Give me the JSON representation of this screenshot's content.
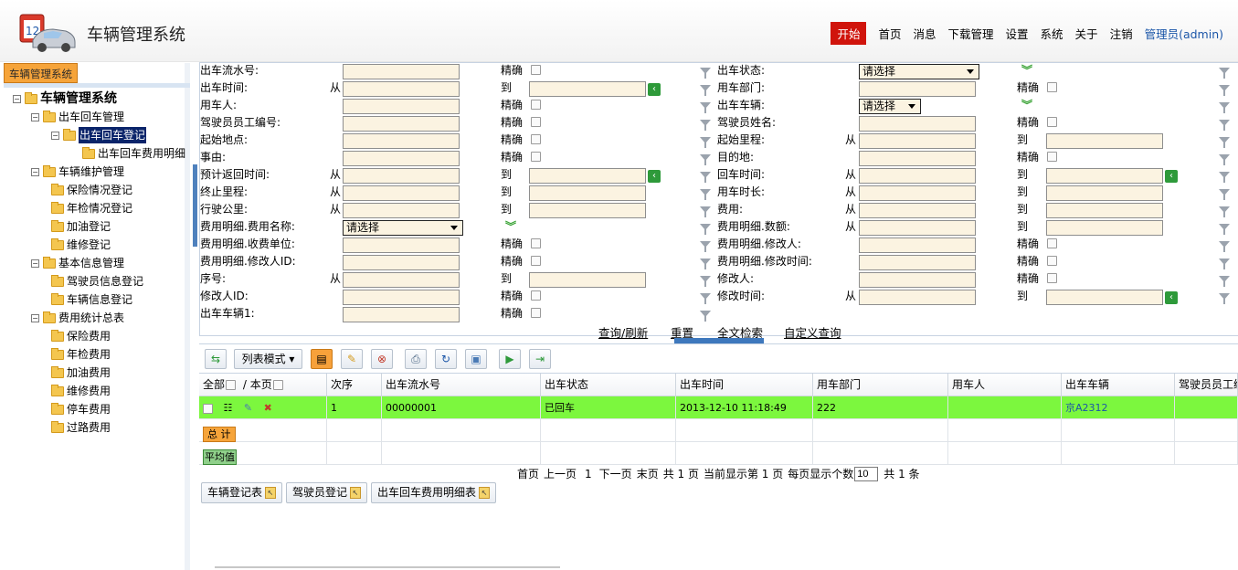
{
  "app": {
    "title": "车辆管理系统"
  },
  "topnav": {
    "start": "开始",
    "items": [
      "首页",
      "消息",
      "下载管理",
      "设置",
      "系统",
      "关于",
      "注销"
    ],
    "user": "管理员(admin)"
  },
  "sidebar": {
    "tab": "车辆管理系统",
    "tree": [
      {
        "label": "车辆管理系统",
        "level": 0,
        "toggle": "⊟"
      },
      {
        "label": "出车回车管理",
        "level": 1,
        "toggle": "⊟"
      },
      {
        "label": "出车回车登记",
        "level": 2,
        "toggle": "⊟",
        "selected": true
      },
      {
        "label": "出车回车费用明细",
        "level": 3
      },
      {
        "label": "车辆维护管理",
        "level": 1,
        "toggle": "⊟"
      },
      {
        "label": "保险情况登记",
        "level": 2
      },
      {
        "label": "年检情况登记",
        "level": 2
      },
      {
        "label": "加油登记",
        "level": 2
      },
      {
        "label": "维修登记",
        "level": 2
      },
      {
        "label": "基本信息管理",
        "level": 1,
        "toggle": "⊟"
      },
      {
        "label": "驾驶员信息登记",
        "level": 2
      },
      {
        "label": "车辆信息登记",
        "level": 2
      },
      {
        "label": "费用统计总表",
        "level": 1,
        "toggle": "⊟"
      },
      {
        "label": "保险费用",
        "level": 2
      },
      {
        "label": "年检费用",
        "level": 2
      },
      {
        "label": "加油费用",
        "level": 2
      },
      {
        "label": "维修费用",
        "level": 2
      },
      {
        "label": "停车费用",
        "level": 2
      },
      {
        "label": "过路费用",
        "level": 2
      }
    ]
  },
  "form": {
    "words": {
      "from": "从",
      "to": "到",
      "exact": "精确",
      "select": "请选择"
    },
    "left": [
      {
        "label": "出车流水号:",
        "type": "exact"
      },
      {
        "label": "出车时间:",
        "type": "range",
        "btn": true
      },
      {
        "label": "用车人:",
        "type": "exact"
      },
      {
        "label": "驾驶员员工编号:",
        "type": "exact"
      },
      {
        "label": "起始地点:",
        "type": "exact"
      },
      {
        "label": "事由:",
        "type": "exact"
      },
      {
        "label": "预计返回时间:",
        "type": "range",
        "btn": true
      },
      {
        "label": "终止里程:",
        "type": "range"
      },
      {
        "label": "行驶公里:",
        "type": "range"
      },
      {
        "label": "费用明细.费用名称:",
        "type": "select"
      },
      {
        "label": "费用明细.收费单位:",
        "type": "exact"
      },
      {
        "label": "费用明细.修改人ID:",
        "type": "exact"
      },
      {
        "label": "序号:",
        "type": "range"
      },
      {
        "label": "修改人ID:",
        "type": "exact"
      },
      {
        "label": "出车车辆1:",
        "type": "exact"
      }
    ],
    "right": [
      {
        "label": "出车状态:",
        "type": "select"
      },
      {
        "label": "用车部门:",
        "type": "exact"
      },
      {
        "label": "出车车辆:",
        "type": "select-short"
      },
      {
        "label": "驾驶员姓名:",
        "type": "exact"
      },
      {
        "label": "起始里程:",
        "type": "range"
      },
      {
        "label": "目的地:",
        "type": "exact"
      },
      {
        "label": "回车时间:",
        "type": "range",
        "btn": true
      },
      {
        "label": "用车时长:",
        "type": "range"
      },
      {
        "label": "费用:",
        "type": "range"
      },
      {
        "label": "费用明细.数额:",
        "type": "range"
      },
      {
        "label": "费用明细.修改人:",
        "type": "exact"
      },
      {
        "label": "费用明细.修改时间:",
        "type": "exact"
      },
      {
        "label": "修改人:",
        "type": "exact"
      },
      {
        "label": "修改时间:",
        "type": "range",
        "btn": true
      }
    ],
    "actions": [
      "查询/刷新",
      "重置",
      "全文检索",
      "自定义查询"
    ]
  },
  "toolbar": {
    "list_mode": "列表模式"
  },
  "grid": {
    "select_all": "全部",
    "this_page": "本页",
    "columns": [
      "次序",
      "出车流水号",
      "出车状态",
      "出车时间",
      "用车部门",
      "用车人",
      "出车车辆",
      "驾驶员员工编号"
    ],
    "rows": [
      {
        "seq": "1",
        "serial": "00000001",
        "status": "已回车",
        "time": "2013-12-10 11:18:49",
        "dept": "222",
        "user": "",
        "vehicle": "京A2312",
        "driver": ""
      }
    ],
    "total_label": "总 计",
    "avg_label": "平均值"
  },
  "pager": {
    "first": "首页",
    "prev": "上一页",
    "current": "1",
    "next": "下一页",
    "last": "末页",
    "total_pages": "共 1 页",
    "showing": "当前显示第 1 页",
    "per_page_label": "每页显示个数",
    "per_page": "10",
    "total_records": "共 1 条"
  },
  "bottom_tabs": [
    "车辆登记表",
    "驾驶员登记",
    "出车回车费用明细表"
  ],
  "colors": {
    "accent": "#d0140c",
    "row_highlight": "#7cf73e",
    "input_bg": "#fbf3e1",
    "tab_orange": "#f6a43a"
  }
}
